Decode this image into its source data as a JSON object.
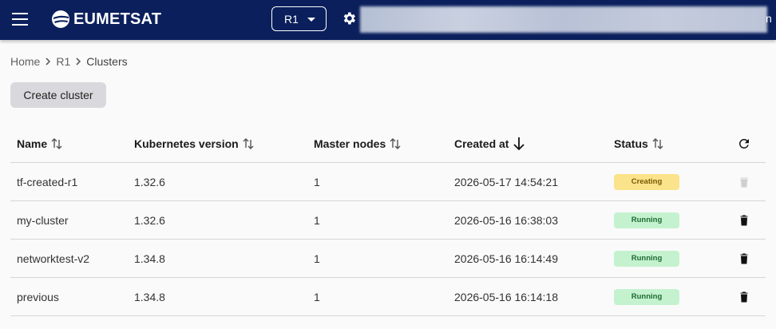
{
  "header": {
    "brand": "EUMETSAT",
    "region": "R1",
    "user_trailing": "n"
  },
  "breadcrumb": {
    "items": [
      "Home",
      "R1"
    ],
    "current": "Clusters"
  },
  "actions": {
    "create_label": "Create cluster"
  },
  "table": {
    "columns": {
      "name": "Name",
      "k8s": "Kubernetes version",
      "master": "Master nodes",
      "created": "Created at",
      "status": "Status"
    },
    "rows": [
      {
        "name": "tf-created-r1",
        "k8s": "1.32.6",
        "master": "1",
        "created": "2026-05-17 14:54:21",
        "status": "Creating"
      },
      {
        "name": "my-cluster",
        "k8s": "1.32.6",
        "master": "1",
        "created": "2026-05-16 16:38:03",
        "status": "Running"
      },
      {
        "name": "networktest-v2",
        "k8s": "1.34.8",
        "master": "1",
        "created": "2026-05-16 16:14:49",
        "status": "Running"
      },
      {
        "name": "previous",
        "k8s": "1.34.8",
        "master": "1",
        "created": "2026-05-16 16:14:18",
        "status": "Running"
      }
    ]
  },
  "colors": {
    "topbar": "#0a1f5c",
    "creating_bg": "#fbe38b",
    "running_bg": "#c4f2cf"
  },
  "icons": [
    "menu-icon",
    "eumetsat-logo-icon",
    "caret-down-icon",
    "gear-icon",
    "chevron-right-icon",
    "sort-icon",
    "arrow-down-icon",
    "refresh-icon",
    "trash-icon"
  ]
}
